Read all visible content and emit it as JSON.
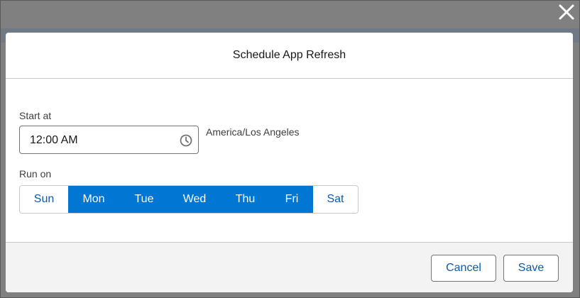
{
  "modal": {
    "title": "Schedule App Refresh"
  },
  "form": {
    "start_at_label": "Start at",
    "start_time": "12:00 AM",
    "time_icon": "clock-icon",
    "timezone": "America/Los Angeles",
    "run_on_label": "Run on",
    "days": [
      {
        "label": "Sun",
        "selected": false
      },
      {
        "label": "Mon",
        "selected": true
      },
      {
        "label": "Tue",
        "selected": true
      },
      {
        "label": "Wed",
        "selected": true
      },
      {
        "label": "Thu",
        "selected": true
      },
      {
        "label": "Fri",
        "selected": true
      },
      {
        "label": "Sat",
        "selected": false
      }
    ]
  },
  "footer": {
    "cancel_label": "Cancel",
    "save_label": "Save"
  },
  "icons": {
    "close": "close-icon"
  },
  "colors": {
    "brand": "#0176d3",
    "brand_text": "#0b5cab",
    "overlay": "#808080"
  }
}
